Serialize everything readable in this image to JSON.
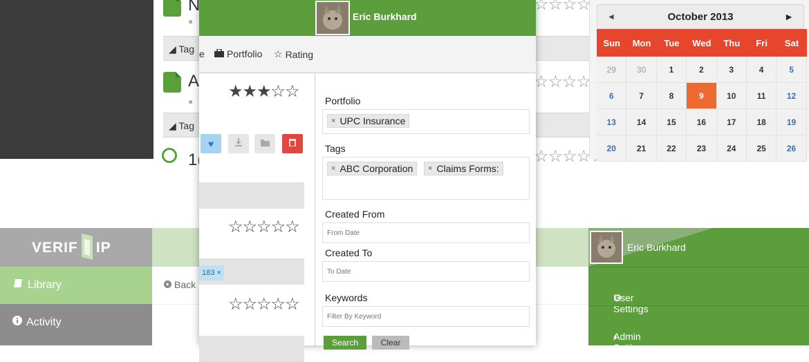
{
  "top_list": {
    "rows": [
      {
        "letter": "N",
        "tag_label": "Tag"
      },
      {
        "letter": "A",
        "tag_label": "Tag"
      },
      {
        "letter": "1("
      }
    ],
    "stars": "☆☆☆☆☆"
  },
  "calendar": {
    "prev": "◄",
    "month_year": "October  2013",
    "next": "►",
    "weekdays": [
      "Sun",
      "Mon",
      "Tue",
      "Wed",
      "Thu",
      "Fri",
      "Sat"
    ],
    "weeks": [
      [
        "29",
        "30",
        "1",
        "2",
        "3",
        "4",
        "5"
      ],
      [
        "6",
        "7",
        "8",
        "9",
        "10",
        "11",
        "12"
      ],
      [
        "13",
        "14",
        "15",
        "16",
        "17",
        "18",
        "19"
      ],
      [
        "20",
        "21",
        "22",
        "23",
        "24",
        "25",
        "26"
      ]
    ],
    "today": "9",
    "colors": {
      "header": "#e8462c",
      "today": "#ec6a32",
      "weekend": "#3b6fb6"
    }
  },
  "modal": {
    "user_name": "Eric Burkhard",
    "tabs": {
      "partial": "e",
      "portfolio": "Portfolio",
      "rating": "Rating"
    },
    "ratings": [
      "★★★☆☆",
      "☆☆☆☆☆",
      "☆☆☆☆☆"
    ],
    "tag_chip": "183 ×",
    "form": {
      "portfolio_label": "Portfolio",
      "portfolio_chips": [
        "UPC Insurance"
      ],
      "tags_label": "Tags",
      "tag_chips": [
        "ABC Corporation",
        "Claims Forms:"
      ],
      "chip_remove": "×",
      "created_from_label": "Created From",
      "created_from_placeholder": "From Date",
      "created_to_label": "Created To",
      "created_to_placeholder": "To Date",
      "keywords_label": "Keywords",
      "keywords_placeholder": "Filter By Keyword",
      "search_label": "Search",
      "clear_label": "Clear"
    }
  },
  "app": {
    "logo_text": "VERIF",
    "logo_suffix": "IP",
    "nav": {
      "library": "Library",
      "activity": "Activity"
    },
    "back_label": "Back"
  },
  "user_panel": {
    "name": "Eric Burkhard",
    "items": [
      "User Settings",
      "Admin Settings"
    ]
  },
  "colors": {
    "brand_green": "#5b9e3b",
    "light_green": "#a8d38f",
    "dark": "#3c3c3c"
  }
}
